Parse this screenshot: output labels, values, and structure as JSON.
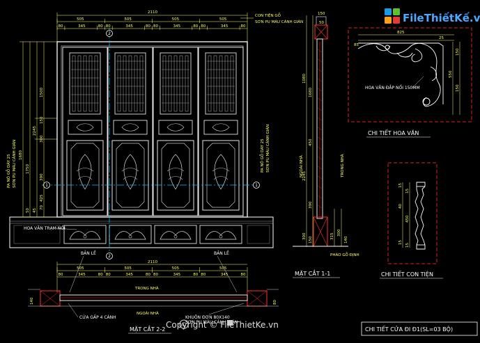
{
  "logo": {
    "text": "FileThiếtKế.vn"
  },
  "watermark": {
    "text": "Copyright © FileThietKe.vn"
  },
  "elevation": {
    "overall_width": "2110",
    "top_dims": [
      "505",
      "505",
      "505",
      "505"
    ],
    "sub_dims": [
      "80",
      "345",
      "80",
      "80",
      "345",
      "80",
      "80",
      "345",
      "80",
      "80",
      "345",
      "80"
    ],
    "left_dims": [
      "1680",
      "1750",
      "2245",
      "1500",
      "300",
      "150",
      "390",
      "425",
      "70",
      "45",
      "50"
    ],
    "notes": {
      "top_right": "CON TIỆN GỖ",
      "top_right_2": "SƠN PU MÀU CÁNH GIÁN",
      "left_a": "PA NÔ GỖ DÀY 25",
      "left_b": "SƠN PU MÀU CÁNH GIÁN",
      "transom": "HOA VĂN TRẠM NỔI",
      "right_a": "PA NÔ GỖ DÀY 25",
      "right_b": "SƠN PU MÀU CÁNH GIÁN"
    },
    "markers": [
      "1",
      "1",
      "2",
      "2"
    ]
  },
  "section_1_1": {
    "title": "MẶT CẮT 1-1",
    "outside": "NGOÀI NHÀ",
    "inside": "TRONG NHÀ",
    "note_bottom": "PHÀO GỖ ĐỊNH",
    "dims_left": [
      "2245",
      "1680",
      "1080",
      "450",
      "390",
      "300",
      "150"
    ],
    "dims_top": [
      "150",
      "50"
    ],
    "dims_right": [
      "315",
      "300",
      "140"
    ]
  },
  "section_2_2": {
    "title": "MẶT CẮT 2-2",
    "inside": "TRONG NHÀ",
    "outside": "NGOÀI NHÀ",
    "hinge_left": "BẢN LỀ",
    "hinge_right": "BẢN LỀ",
    "door_note": "CỬA GẤP 4 CÁNH",
    "frame_note_1": "KHUÔN ĐƠN 80X140",
    "frame_note_2": "SƠN PU MÀU CÁNH GIÁN",
    "overall_width": "2110",
    "top_dims": [
      "505",
      "505",
      "505",
      "505"
    ],
    "sub_dims": [
      "80",
      "345",
      "80",
      "80",
      "345",
      "80",
      "80",
      "345",
      "80",
      "80",
      "345",
      "80"
    ],
    "side_dims": [
      "140",
      "80"
    ]
  },
  "hoa_van": {
    "title": "CHI TIẾT HOA VĂN",
    "note": "HOA VĂN ĐẮP NỔI 150MM",
    "dims": [
      "825",
      "25",
      "150",
      "150",
      "550",
      "85"
    ]
  },
  "con_tien": {
    "title": "CHI TIẾT CON TIỆN",
    "dims": [
      "15",
      "15",
      "40",
      "450",
      "15",
      "15"
    ]
  },
  "footer": {
    "title": "CHI TIẾT CỬA ĐI Đ1(SL=03 BỘ)"
  },
  "colors": {
    "background": "#000000",
    "frame": "#ffffff",
    "dimension": "#ffff66",
    "section_red": "#ff3030",
    "detail_border": "#e02020",
    "center_line": "#00c8ff",
    "hatch": "#7ae7ff"
  }
}
